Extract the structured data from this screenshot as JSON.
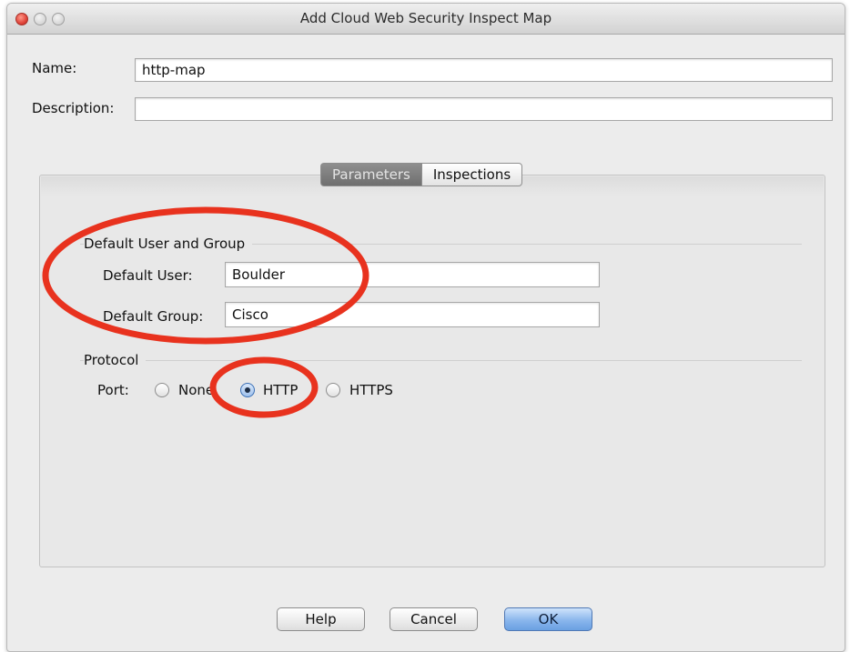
{
  "window": {
    "title": "Add Cloud Web Security Inspect Map"
  },
  "form": {
    "name_label": "Name:",
    "name_value": "http-map",
    "description_label": "Description:",
    "description_value": ""
  },
  "tabs": [
    {
      "label": "Parameters",
      "selected": true
    },
    {
      "label": "Inspections",
      "selected": false
    }
  ],
  "default_user_group": {
    "title": "Default User and Group",
    "user_label": "Default User:",
    "user_value": "Boulder",
    "group_label": "Default Group:",
    "group_value": "Cisco"
  },
  "protocol": {
    "title": "Protocol",
    "port_label": "Port:",
    "options": [
      {
        "label": "None",
        "checked": false
      },
      {
        "label": "HTTP",
        "checked": true
      },
      {
        "label": "HTTPS",
        "checked": false
      }
    ]
  },
  "buttons": {
    "help": "Help",
    "cancel": "Cancel",
    "ok": "OK"
  },
  "colors": {
    "annotation": "#e8321e",
    "primary_button": "#7aaae6",
    "selected_tab": "#7f7f7f"
  }
}
